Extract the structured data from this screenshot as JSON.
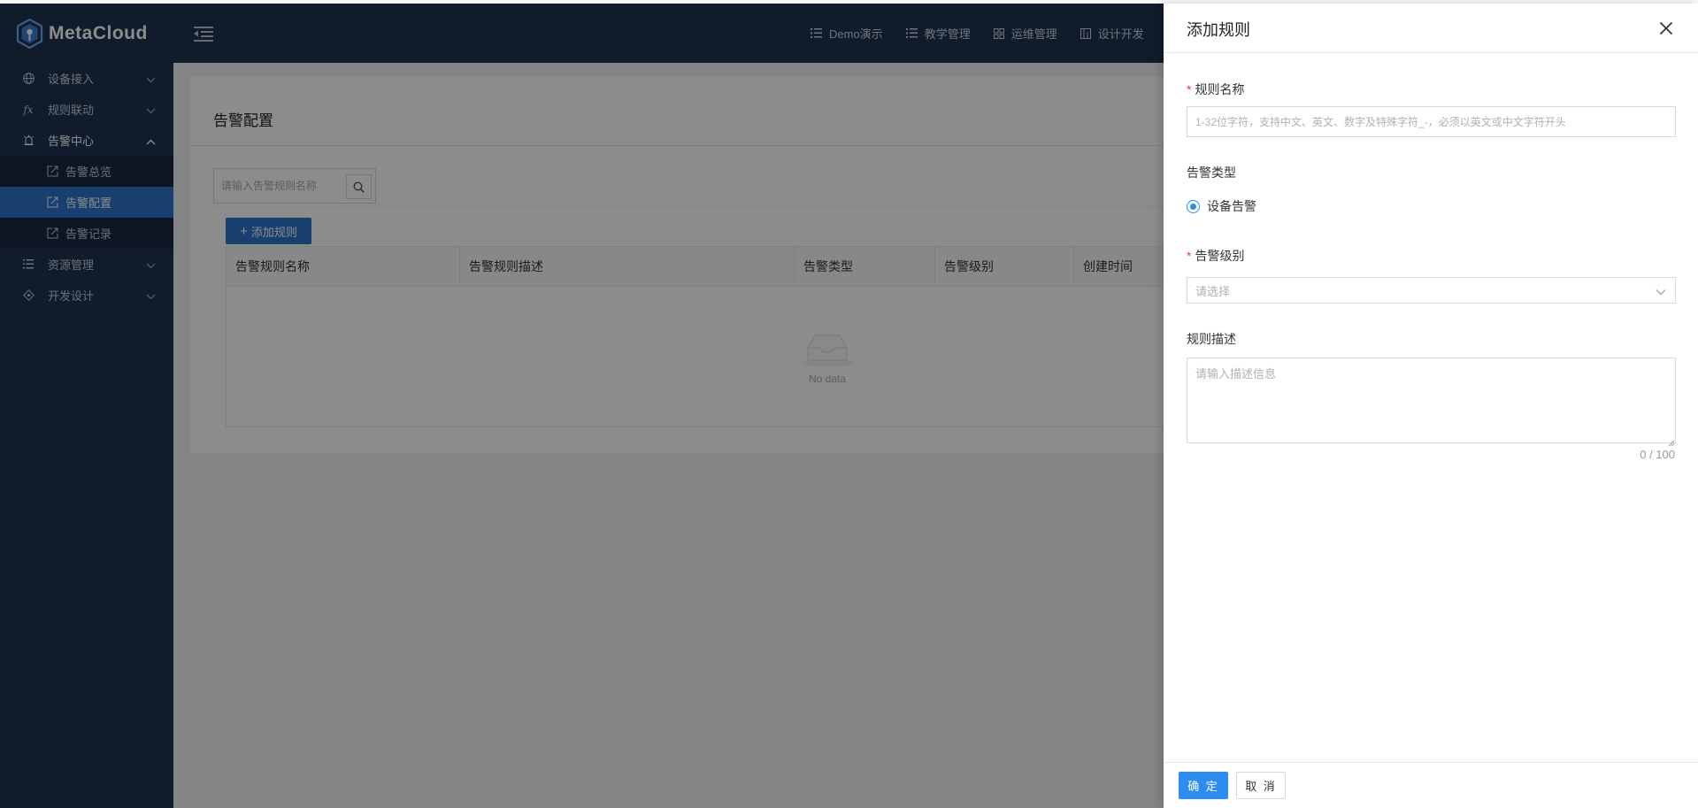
{
  "app": {
    "logo_text": "MetaCloud"
  },
  "topnav": [
    {
      "label": "Demo演示",
      "icon": "list-icon"
    },
    {
      "label": "教学管理",
      "icon": "list-icon"
    },
    {
      "label": "运维管理",
      "icon": "grid-icon"
    },
    {
      "label": "设计开发",
      "icon": "layout-icon"
    }
  ],
  "sidebar": {
    "items": [
      {
        "label": "设备接入",
        "icon": "globe-icon",
        "expanded": false
      },
      {
        "label": "规则联动",
        "icon": "fx-icon",
        "expanded": false
      },
      {
        "label": "告警中心",
        "icon": "alarm-icon",
        "expanded": true,
        "children": [
          {
            "label": "告警总览",
            "active": false
          },
          {
            "label": "告警配置",
            "active": true
          },
          {
            "label": "告警记录",
            "active": false
          }
        ]
      },
      {
        "label": "资源管理",
        "icon": "list-icon",
        "expanded": false
      },
      {
        "label": "开发设计",
        "icon": "diamond-icon",
        "expanded": false
      }
    ]
  },
  "main": {
    "page_title": "告警配置",
    "search_placeholder": "请输入告警规则名称",
    "add_button_label": "添加规则",
    "table": {
      "columns": [
        "告警规则名称",
        "告警规则描述",
        "告警类型",
        "告警级别",
        "创建时间"
      ],
      "empty_text": "No data"
    }
  },
  "drawer": {
    "title": "添加规则",
    "fields": {
      "name": {
        "label": "规则名称",
        "required": true,
        "placeholder": "1-32位字符，支持中文、英文、数字及特殊字符_-，必须以英文或中文字符开头",
        "value": ""
      },
      "type": {
        "label": "告警类型",
        "options": [
          "设备告警"
        ],
        "selected": "设备告警"
      },
      "level": {
        "label": "告警级别",
        "required": true,
        "placeholder": "请选择"
      },
      "description": {
        "label": "规则描述",
        "placeholder": "请输入描述信息",
        "value": "",
        "counter": "0 / 100"
      }
    },
    "footer": {
      "confirm_label": "确 定",
      "cancel_label": "取 消"
    }
  },
  "colors": {
    "header_bg": "#1e3450",
    "primary": "#2d74c6",
    "drawer_primary": "#2d8cf0",
    "required_star": "#e8453c"
  }
}
